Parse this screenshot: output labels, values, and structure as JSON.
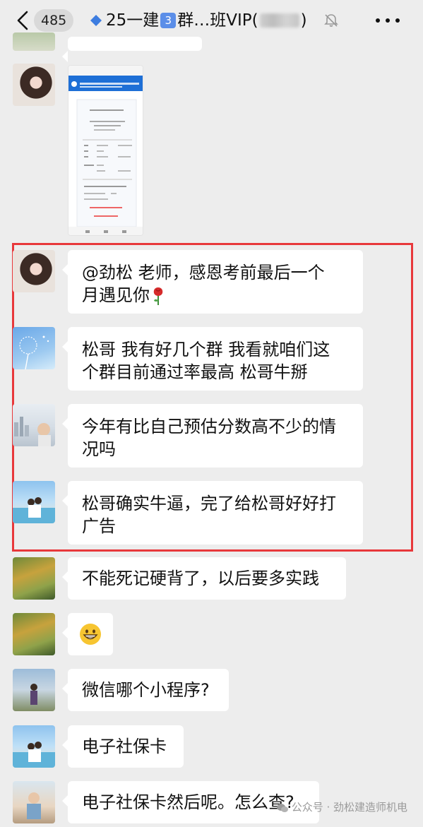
{
  "header": {
    "unread_count": "485",
    "title_prefix": "25一建",
    "title_number": "3",
    "title_suffix_a": "群…班VIP(",
    "title_suffix_b": ")",
    "back_icon": "chevron-left-icon",
    "mute_icon": "bell-off-icon",
    "more_icon": "ellipsis-icon"
  },
  "messages": [
    {
      "text": "@劲松  老师，感恩考前最后一个月遇见你",
      "line1": "@劲松  老师，感恩考前最后一个",
      "line2": "月遇见你",
      "emoji": "rose"
    },
    {
      "line1": "松哥  我有好几个群  我看就咱们这",
      "line2": "个群目前通过率最高  松哥牛掰"
    },
    {
      "line1": "今年有比自己预估分数高不少的情",
      "line2": "况吗"
    },
    {
      "line1": "松哥确实牛逼，完了给松哥好好打",
      "line2": "广告"
    },
    {
      "line1": "不能死记硬背了，以后要多实践"
    },
    {
      "emoji": "grinning-face"
    },
    {
      "line1": "微信哪个小程序?"
    },
    {
      "line1": "电子社保卡"
    },
    {
      "line1": "电子社保卡然后呢。怎么查?"
    }
  ],
  "watermark": "公众号 · 劲松建造师机电",
  "colors": {
    "background": "#ededed",
    "bubble": "#ffffff",
    "highlight_border": "#e8383b",
    "badge_bg": "#d9d9d9"
  }
}
